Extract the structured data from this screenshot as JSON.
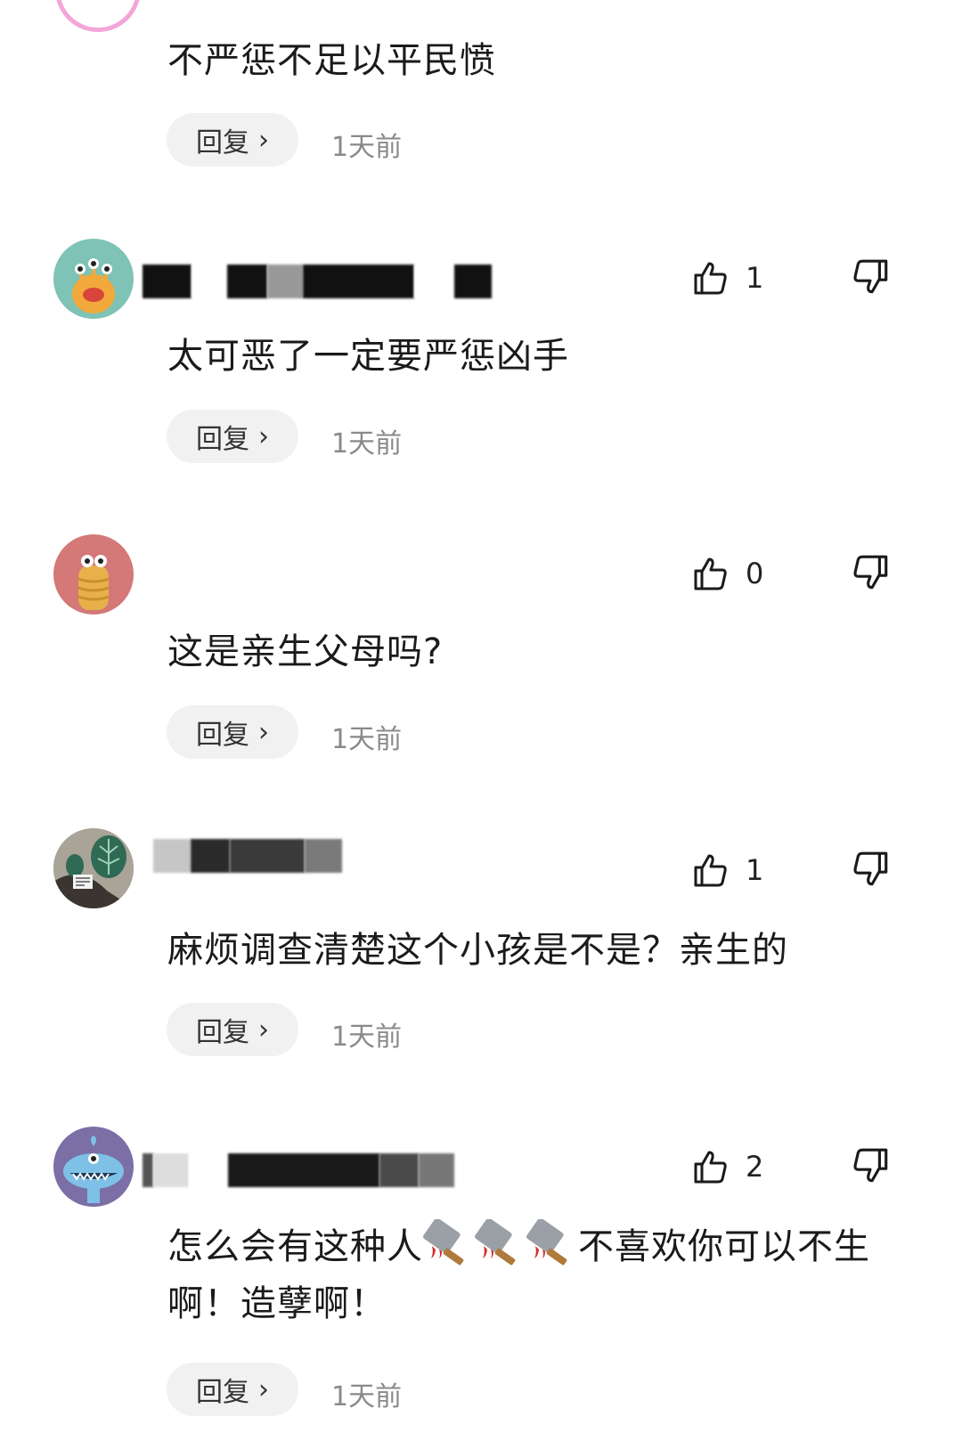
{
  "comments": [
    {
      "text": "不严惩不足以平民愤",
      "reply_label": "回复",
      "time": "1天前"
    },
    {
      "like_count": "1",
      "text": "太可恶了一定要严惩凶手",
      "reply_label": "回复",
      "time": "1天前"
    },
    {
      "like_count": "0",
      "text": "这是亲生父母吗?",
      "reply_label": "回复",
      "time": "1天前"
    },
    {
      "like_count": "1",
      "text": "麻烦调查清楚这个小孩是不是？亲生的",
      "reply_label": "回复",
      "time": "1天前"
    },
    {
      "like_count": "2",
      "text_part1": "怎么会有这种人",
      "text_part2": "不喜欢你可以不生",
      "text_line2": "啊！造孽啊！",
      "reply_label": "回复",
      "time": "1天前"
    }
  ],
  "icons": {
    "like": "thumbs-up-icon",
    "dislike": "thumbs-down-icon",
    "reply_chevron": "chevron-right-icon",
    "emoji": "bloody-cleaver-emoji"
  },
  "colors": {
    "reply_bg": "#f1f1f1",
    "time_text": "#8a8a8a",
    "text": "#1a1a1a"
  }
}
